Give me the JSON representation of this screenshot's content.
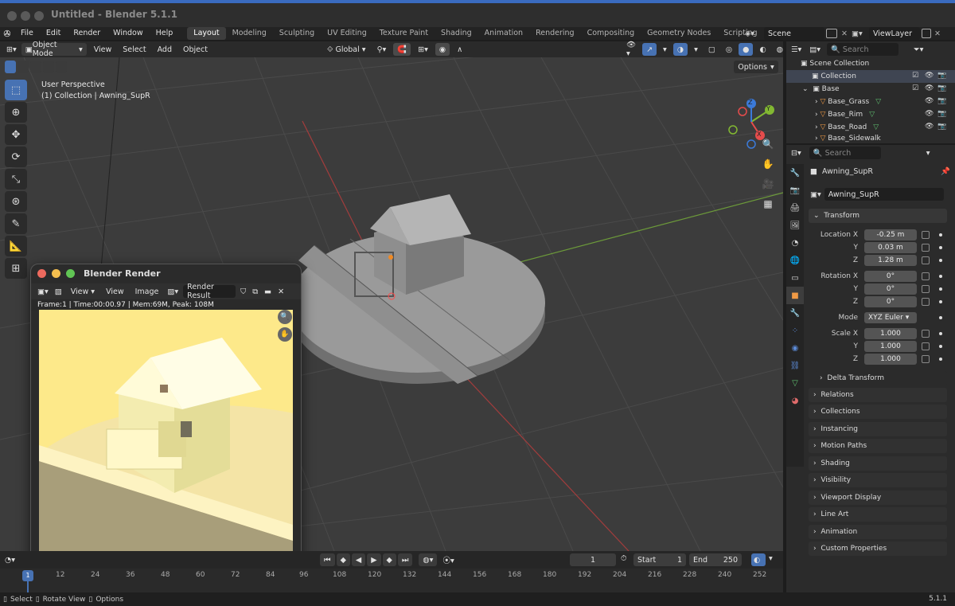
{
  "window": {
    "title": "Untitled - Blender 5.1.1"
  },
  "menubar": {
    "items": [
      "File",
      "Edit",
      "Render",
      "Window",
      "Help"
    ],
    "workspaces": [
      "Layout",
      "Modeling",
      "Sculpting",
      "UV Editing",
      "Texture Paint",
      "Shading",
      "Animation",
      "Rendering",
      "Compositing",
      "Geometry Nodes",
      "Scripting"
    ],
    "add_tab": "+",
    "scene": "Scene",
    "view_layer": "ViewLayer"
  },
  "viewport_header": {
    "mode": "Object Mode",
    "menus": [
      "View",
      "Select",
      "Add",
      "Object"
    ],
    "orientation": "Global",
    "options": "Options"
  },
  "viewport": {
    "perspective": "User Perspective",
    "collection_info": "(1) Collection | Awning_SupR"
  },
  "render_window": {
    "title": "Blender Render",
    "view": "View",
    "view2": "View",
    "image": "Image",
    "render_result": "Render Result",
    "info": "Frame:1 | Time:00:00.97 | Mem:69M, Peak: 108M",
    "bg_color": "#fde98a"
  },
  "timeline": {
    "current_frame": "1",
    "start_label": "Start",
    "start": "1",
    "end_label": "End",
    "end": "250",
    "ticks": [
      "1",
      "12",
      "24",
      "36",
      "48",
      "60",
      "72",
      "84",
      "96",
      "108",
      "120",
      "132",
      "144",
      "156",
      "168",
      "180",
      "192",
      "204",
      "216",
      "228",
      "240",
      "252"
    ]
  },
  "statusbar": {
    "select": "Select",
    "rotate": "Rotate View",
    "options": "Options",
    "version": "5.1.1"
  },
  "outliner": {
    "search_placeholder": "Search",
    "scene_collection": "Scene Collection",
    "collection": "Collection",
    "base": "Base",
    "children": [
      "Base_Grass",
      "Base_Rim",
      "Base_Road",
      "Base_Sidewalk"
    ]
  },
  "properties": {
    "search_placeholder": "Search",
    "object_name": "Awning_SupR",
    "data_name": "Awning_SupR",
    "transform_label": "Transform",
    "location_label": "Location X",
    "location": [
      "-0.25 m",
      "0.03 m",
      "1.28 m"
    ],
    "rotation_label": "Rotation X",
    "rotation": [
      "0°",
      "0°",
      "0°"
    ],
    "mode_label": "Mode",
    "mode": "XYZ Euler",
    "scale_label": "Scale X",
    "scale": [
      "1.000",
      "1.000",
      "1.000"
    ],
    "axis_y": "Y",
    "axis_z": "Z",
    "delta_transform": "Delta Transform",
    "panels": [
      "Relations",
      "Collections",
      "Instancing",
      "Motion Paths",
      "Shading",
      "Visibility",
      "Viewport Display",
      "Line Art",
      "Animation",
      "Custom Properties"
    ]
  },
  "gizmo": {
    "x": "X",
    "y": "Y",
    "z": "Z"
  },
  "colors": {
    "accent": "#4772b3",
    "x_axis": "#e64c4c",
    "y_axis": "#82b832",
    "z_axis": "#3b7ad9"
  }
}
